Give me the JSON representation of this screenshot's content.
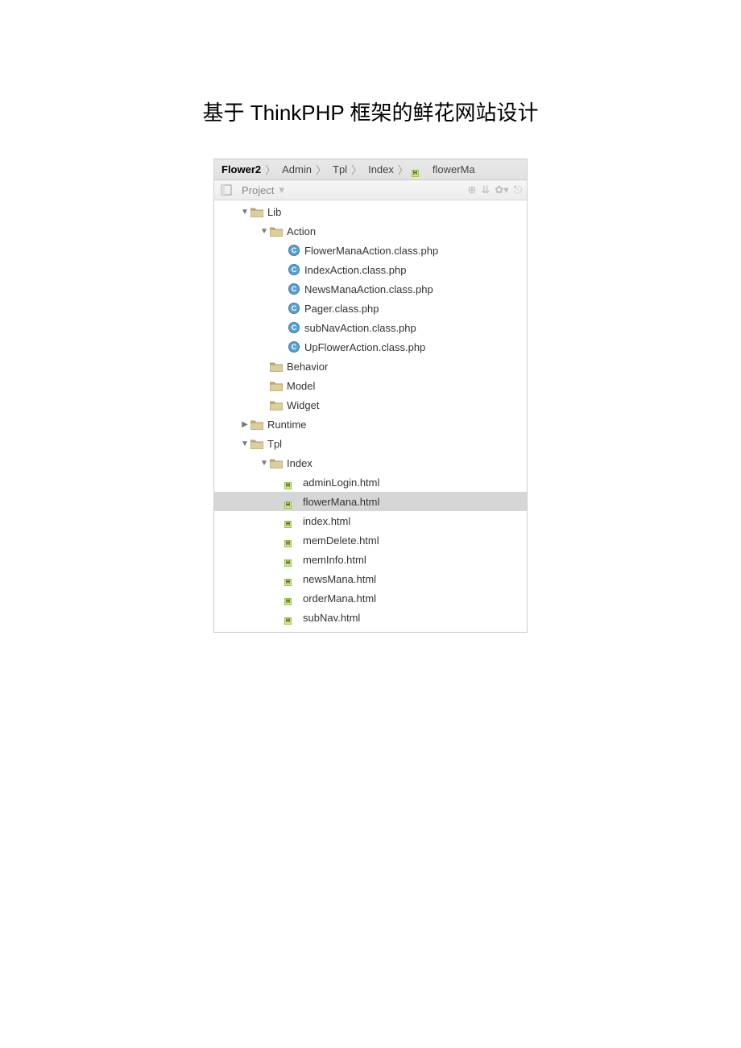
{
  "title": "基于 ThinkPHP 框架的鲜花网站设计",
  "breadcrumb": [
    "Flower2",
    "Admin",
    "Tpl",
    "Index",
    "flowerMa"
  ],
  "toolwindow": {
    "label": "Project"
  },
  "tree": {
    "lib": {
      "label": "Lib",
      "action": {
        "label": "Action",
        "files": [
          "FlowerManaAction.class.php",
          "IndexAction.class.php",
          "NewsManaAction.class.php",
          "Pager.class.php",
          "subNavAction.class.php",
          "UpFlowerAction.class.php"
        ]
      },
      "behavior": "Behavior",
      "model": "Model",
      "widget": "Widget"
    },
    "runtime": "Runtime",
    "tpl": {
      "label": "Tpl",
      "index": {
        "label": "Index",
        "files": [
          "adminLogin.html",
          "flowerMana.html",
          "index.html",
          "memDelete.html",
          "memInfo.html",
          "newsMana.html",
          "orderMana.html",
          "subNav.html"
        ]
      }
    },
    "selected": "flowerMana.html"
  }
}
